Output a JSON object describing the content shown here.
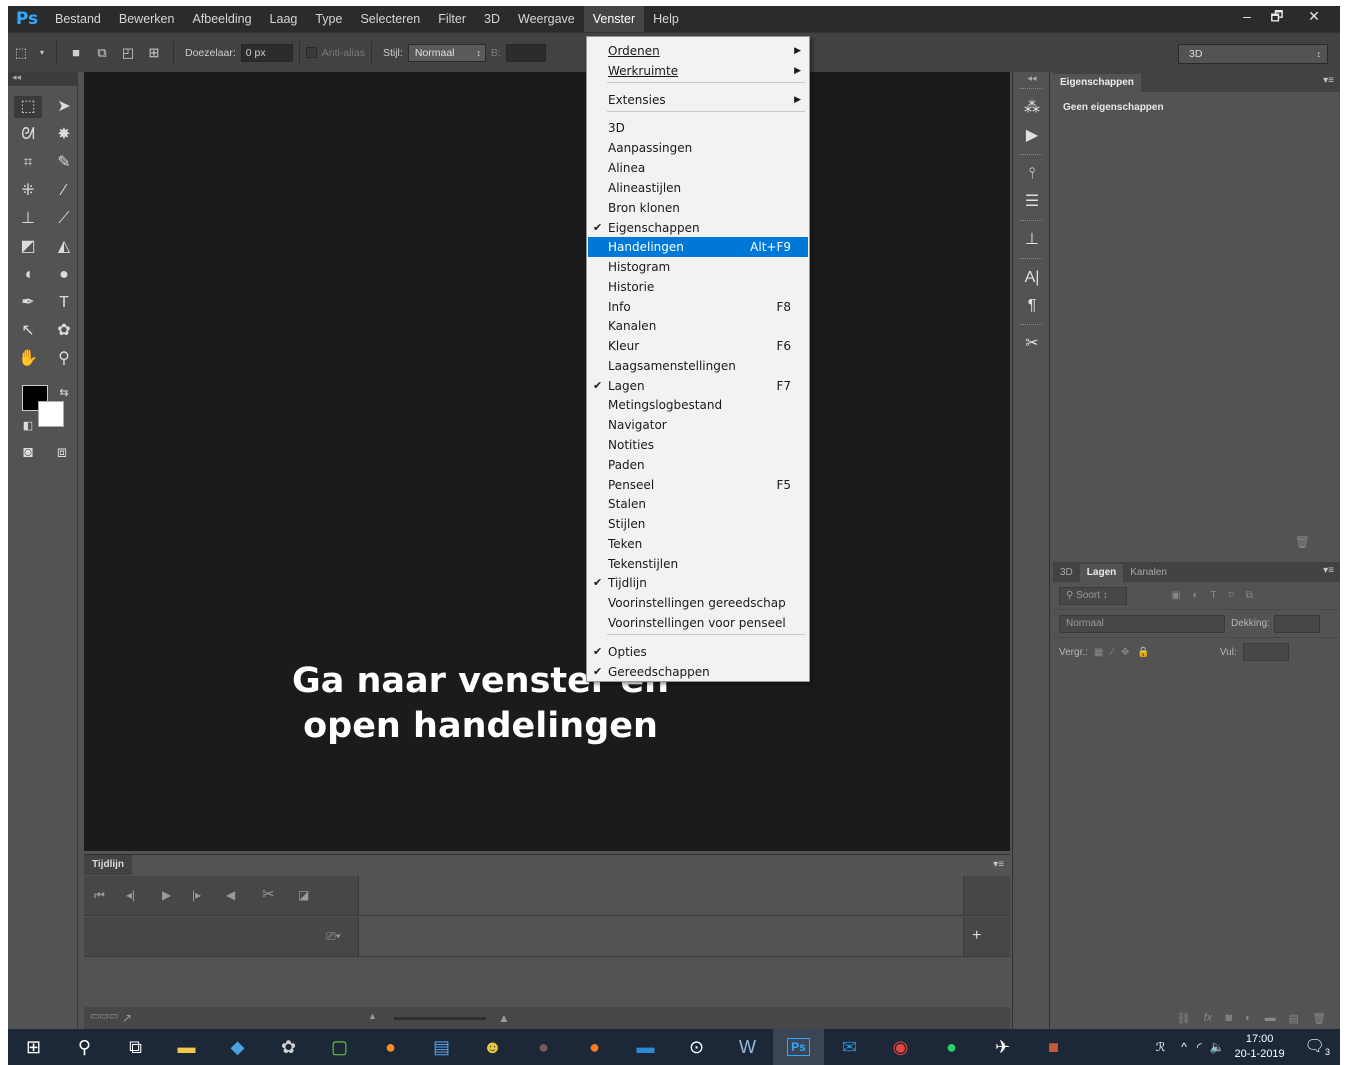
{
  "menubar": {
    "logo": "Ps",
    "items": [
      "Bestand",
      "Bewerken",
      "Afbeelding",
      "Laag",
      "Type",
      "Selecteren",
      "Filter",
      "3D",
      "Weergave",
      "Venster",
      "Help"
    ],
    "active_index": 9,
    "window_controls": [
      "–",
      "🗗",
      "✕"
    ]
  },
  "options_bar": {
    "feather_label": "Doezelaar:",
    "feather_value": "0 px",
    "antialias_label": "Anti-alias",
    "style_label": "Stijl:",
    "style_value": "Normaal",
    "width_label": "B:",
    "workspace_value": "3D"
  },
  "venster_menu": {
    "items": [
      {
        "label": "Ordenen",
        "shortcut": "",
        "checked": false,
        "submenu": true
      },
      {
        "label": "Werkruimte",
        "shortcut": "",
        "checked": false,
        "submenu": true
      },
      {
        "label": "Extensies",
        "shortcut": "",
        "checked": false,
        "submenu": true
      },
      {
        "label": "3D",
        "shortcut": "",
        "checked": false,
        "submenu": false
      },
      {
        "label": "Aanpassingen",
        "shortcut": "",
        "checked": false,
        "submenu": false
      },
      {
        "label": "Alinea",
        "shortcut": "",
        "checked": false,
        "submenu": false
      },
      {
        "label": "Alineastijlen",
        "shortcut": "",
        "checked": false,
        "submenu": false
      },
      {
        "label": "Bron klonen",
        "shortcut": "",
        "checked": false,
        "submenu": false
      },
      {
        "label": "Eigenschappen",
        "shortcut": "",
        "checked": true,
        "submenu": false
      },
      {
        "label": "Handelingen",
        "shortcut": "Alt+F9",
        "checked": false,
        "submenu": false,
        "highlighted": true
      },
      {
        "label": "Histogram",
        "shortcut": "",
        "checked": false,
        "submenu": false
      },
      {
        "label": "Historie",
        "shortcut": "",
        "checked": false,
        "submenu": false
      },
      {
        "label": "Info",
        "shortcut": "F8",
        "checked": false,
        "submenu": false
      },
      {
        "label": "Kanalen",
        "shortcut": "",
        "checked": false,
        "submenu": false
      },
      {
        "label": "Kleur",
        "shortcut": "F6",
        "checked": false,
        "submenu": false
      },
      {
        "label": "Laagsamenstellingen",
        "shortcut": "",
        "checked": false,
        "submenu": false
      },
      {
        "label": "Lagen",
        "shortcut": "F7",
        "checked": true,
        "submenu": false
      },
      {
        "label": "Metingslogbestand",
        "shortcut": "",
        "checked": false,
        "submenu": false
      },
      {
        "label": "Navigator",
        "shortcut": "",
        "checked": false,
        "submenu": false
      },
      {
        "label": "Notities",
        "shortcut": "",
        "checked": false,
        "submenu": false
      },
      {
        "label": "Paden",
        "shortcut": "",
        "checked": false,
        "submenu": false
      },
      {
        "label": "Penseel",
        "shortcut": "F5",
        "checked": false,
        "submenu": false
      },
      {
        "label": "Stalen",
        "shortcut": "",
        "checked": false,
        "submenu": false
      },
      {
        "label": "Stijlen",
        "shortcut": "",
        "checked": false,
        "submenu": false
      },
      {
        "label": "Teken",
        "shortcut": "",
        "checked": false,
        "submenu": false
      },
      {
        "label": "Tekenstijlen",
        "shortcut": "",
        "checked": false,
        "submenu": false
      },
      {
        "label": "Tijdlijn",
        "shortcut": "",
        "checked": true,
        "submenu": false
      },
      {
        "label": "Voorinstellingen gereedschap",
        "shortcut": "",
        "checked": false,
        "submenu": false
      },
      {
        "label": "Voorinstellingen voor penseel",
        "shortcut": "",
        "checked": false,
        "submenu": false
      },
      {
        "label": "Opties",
        "shortcut": "",
        "checked": true,
        "submenu": false
      },
      {
        "label": "Gereedschappen",
        "shortcut": "",
        "checked": true,
        "submenu": false
      }
    ],
    "highlight_color": "#0078d7"
  },
  "canvas": {
    "overlay_line1": "Ga naar venster en",
    "overlay_line2": "open handelingen"
  },
  "timeline": {
    "tab": "Tijdlijn"
  },
  "properties_panel": {
    "tab": "Eigenschappen",
    "empty_text": "Geen eigenschappen"
  },
  "layers_panel": {
    "tabs": [
      "3D",
      "Lagen",
      "Kanalen"
    ],
    "active_tab": 1,
    "filter_label": "Soort",
    "blend_mode": "Normaal",
    "opacity_label": "Dekking:",
    "lock_label": "Vergr.:",
    "fill_label": "Vul:"
  },
  "taskbar": {
    "clock_time": "17:00",
    "clock_date": "20-1-2019",
    "notification_count": "3",
    "active_app": "Ps"
  },
  "colors": {
    "app_bg": "#535353",
    "canvas_bg": "#1b1b1b",
    "menubar_bg": "#2b2b2b",
    "ps_blue": "#31a8ff",
    "taskbar_bg": "#1c2838"
  }
}
